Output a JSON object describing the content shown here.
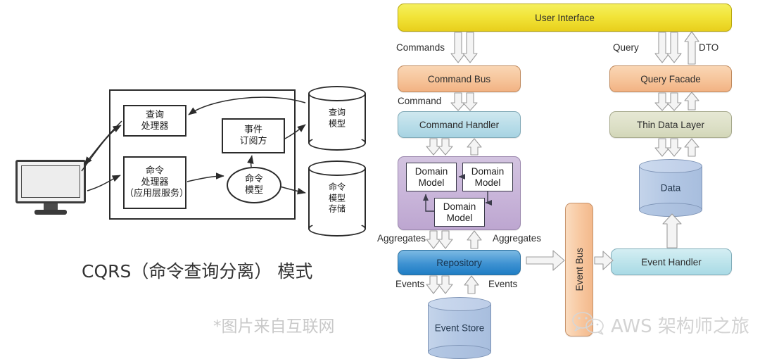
{
  "left_diagram": {
    "title": "CQRS（命令查询分离） 模式",
    "source_note": "*图片来自互联网",
    "monitor": "client-monitor",
    "boxes": [
      {
        "id": "query-handler",
        "label": "查询\n处理器"
      },
      {
        "id": "command-handler",
        "label": "命令\n处理器\n（应用层服务）"
      },
      {
        "id": "event-subscriber",
        "label": "事件\n订阅方"
      }
    ],
    "ellipse": {
      "id": "command-model",
      "label": "命令\n模型"
    },
    "cylinders": [
      {
        "id": "query-model",
        "label": "查询\n模型"
      },
      {
        "id": "command-model-store",
        "label": "命令\n模型\n存储"
      }
    ]
  },
  "right_diagram": {
    "nodes": {
      "user_interface": "User Interface",
      "command_bus": "Command Bus",
      "command_handler": "Command Handler",
      "domain_model_1": "Domain\nModel",
      "domain_model_2": "Domain\nModel",
      "domain_model_3": "Domain\nModel",
      "repository": "Repository",
      "event_store": "Event Store",
      "event_bus": "Event Bus",
      "event_handler": "Event Handler",
      "query_facade": "Query Facade",
      "thin_data_layer": "Thin Data Layer",
      "data": "Data"
    },
    "edge_labels": {
      "commands": "Commands",
      "command": "Command",
      "aggregates_left": "Aggregates",
      "aggregates_right": "Aggregates",
      "events_left": "Events",
      "events_right": "Events",
      "query": "Query",
      "dto": "DTO"
    },
    "colors": {
      "user_interface": "#f2e53a",
      "bus_facade": "#f6c49a",
      "handler": "#b6dce8",
      "domain_panel": "#c8b4d9",
      "repository": "#3e92d2",
      "thin_data_layer": "#dcdfc6",
      "event_bus": "#f8c9a2",
      "cylinder": "#b3c7e4"
    }
  },
  "watermark": {
    "icon": "wechat-icon",
    "text": "AWS 架构师之旅"
  }
}
